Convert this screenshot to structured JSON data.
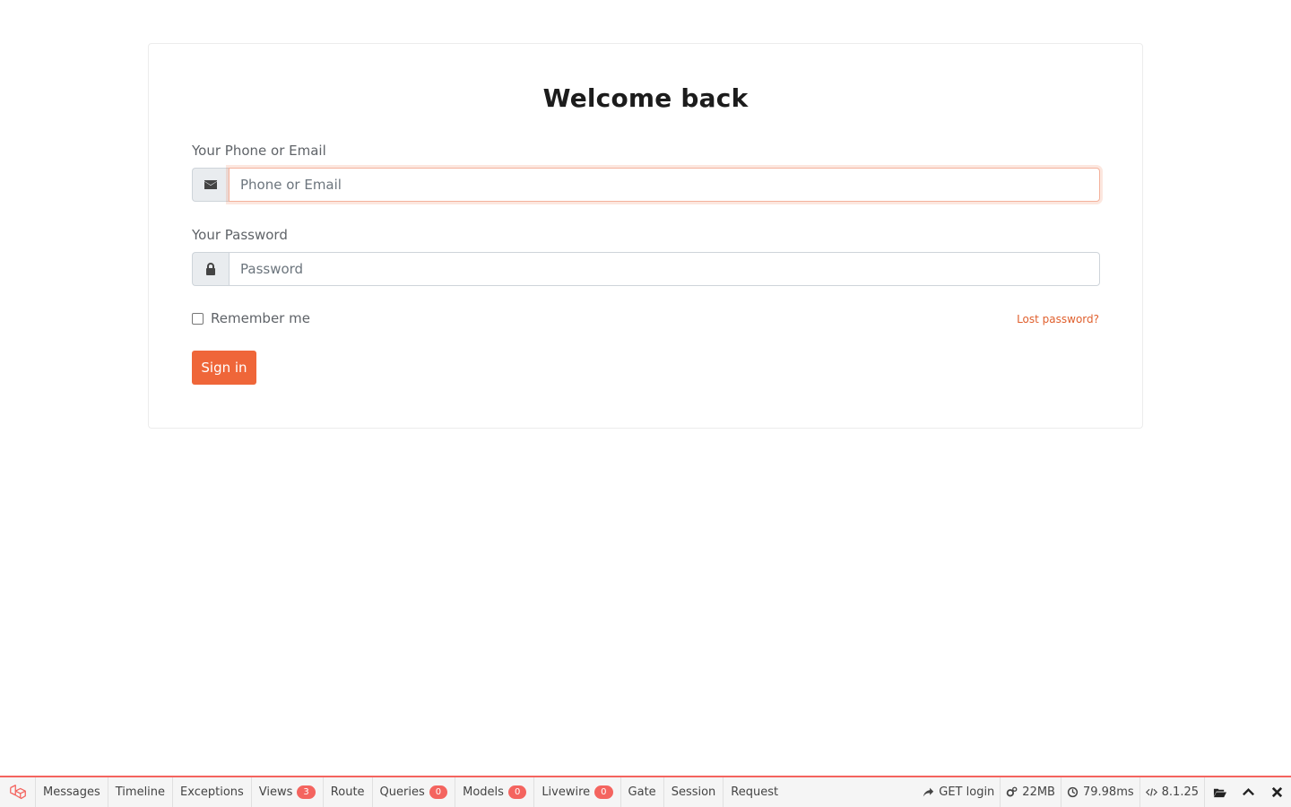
{
  "login": {
    "title": "Welcome back",
    "email_label": "Your Phone or Email",
    "email_placeholder": "Phone or Email",
    "email_value": "",
    "password_label": "Your Password",
    "password_placeholder": "Password",
    "password_value": "",
    "remember_label": "Remember me",
    "remember_checked": false,
    "lost_password_label": "Lost password?",
    "signin_label": "Sign in",
    "accent_color": "#ef6639"
  },
  "debugbar": {
    "tabs": [
      {
        "label": "Messages"
      },
      {
        "label": "Timeline"
      },
      {
        "label": "Exceptions"
      },
      {
        "label": "Views",
        "badge": "3"
      },
      {
        "label": "Route"
      },
      {
        "label": "Queries",
        "badge": "0"
      },
      {
        "label": "Models",
        "badge": "0"
      },
      {
        "label": "Livewire",
        "badge": "0"
      },
      {
        "label": "Gate"
      },
      {
        "label": "Session"
      },
      {
        "label": "Request"
      }
    ],
    "request": "GET login",
    "memory": "22MB",
    "time": "79.98ms",
    "php_version": "8.1.25",
    "accent_color": "#f4645f"
  }
}
